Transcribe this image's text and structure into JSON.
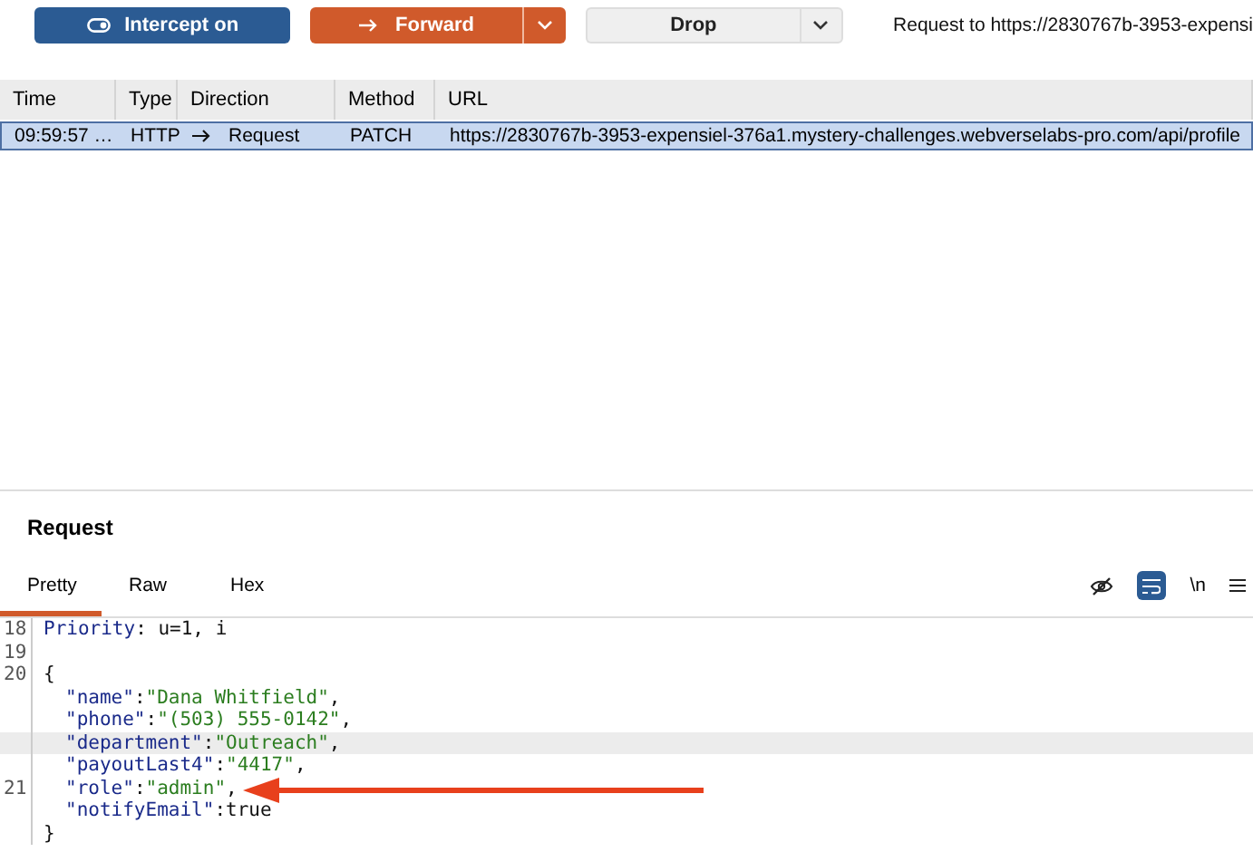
{
  "toolbar": {
    "intercept_button": "Intercept on",
    "forward_button": "Forward",
    "drop_button": "Drop",
    "request_info": "Request to https://2830767b-3953-expensi"
  },
  "table": {
    "columns": [
      "Time",
      "Type",
      "Direction",
      "Method",
      "URL"
    ],
    "rows": [
      {
        "selected": true,
        "cells": [
          "09:59:57 …",
          "HTTP",
          "Request",
          "PATCH",
          "https://2830767b-3953-expensiel-376a1.mystery-challenges.webverselabs-pro.com/api/profile"
        ]
      }
    ]
  },
  "editor": {
    "title": "Request",
    "tabs": [
      {
        "label": "Pretty",
        "selected": true
      },
      {
        "label": "Raw",
        "selected": false
      },
      {
        "label": "Hex",
        "selected": false
      }
    ],
    "newline_toggle": "\\n",
    "lines": [
      {
        "number": "18",
        "highlighted": false,
        "parts": [
          {
            "kind": "key",
            "text": "Priority"
          },
          {
            "kind": "plain",
            "text": ": u=1, i"
          }
        ]
      },
      {
        "number": "19",
        "highlighted": false
      },
      {
        "number": "20",
        "highlighted": false,
        "parts": [
          {
            "kind": "plain",
            "text": "{"
          }
        ],
        "children": [
          {
            "highlighted": false,
            "parts": [
              {
                "kind": "key",
                "text": "\"name\""
              },
              {
                "kind": "plain",
                "text": ":"
              },
              {
                "kind": "string",
                "text": "\"Dana Whitfield\""
              },
              {
                "kind": "plain",
                "text": ","
              }
            ]
          },
          {
            "highlighted": false,
            "parts": [
              {
                "kind": "key",
                "text": "\"phone\""
              },
              {
                "kind": "plain",
                "text": ":"
              },
              {
                "kind": "string",
                "text": "\"(503) 555-0142\""
              },
              {
                "kind": "plain",
                "text": ","
              }
            ]
          },
          {
            "highlighted": true,
            "parts": [
              {
                "kind": "key",
                "text": "\"department\""
              },
              {
                "kind": "plain",
                "text": ":"
              },
              {
                "kind": "string",
                "text": "\"Outreach\""
              },
              {
                "kind": "plain",
                "text": ","
              }
            ]
          },
          {
            "highlighted": false,
            "parts": [
              {
                "kind": "key",
                "text": "\"payoutLast4\""
              },
              {
                "kind": "plain",
                "text": ":"
              },
              {
                "kind": "string",
                "text": "\"4417\""
              },
              {
                "kind": "plain",
                "text": ","
              }
            ]
          },
          {
            "number": "21",
            "highlighted": false,
            "parts": [
              {
                "kind": "key",
                "text": "\"role\""
              },
              {
                "kind": "plain",
                "text": ":"
              },
              {
                "kind": "string",
                "text": "\"admin\""
              },
              {
                "kind": "plain",
                "text": ","
              }
            ]
          },
          {
            "highlighted": false,
            "parts": [
              {
                "kind": "key",
                "text": "\"notifyEmail\""
              },
              {
                "kind": "plain",
                "text": ":true"
              }
            ]
          }
        ]
      },
      {
        "highlighted": false,
        "parts": [
          {
            "kind": "plain",
            "text": "}"
          }
        ]
      }
    ]
  }
}
